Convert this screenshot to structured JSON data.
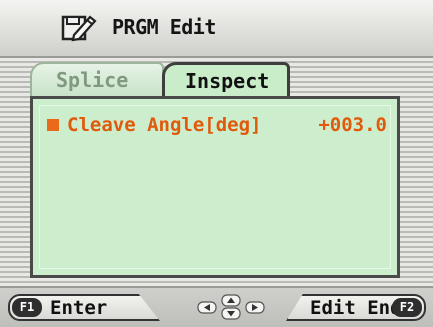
{
  "title": {
    "text": "PRGM Edit",
    "icon": "program-edit-icon"
  },
  "tabs": [
    {
      "label": "Splice",
      "active": false
    },
    {
      "label": "Inspect",
      "active": true
    }
  ],
  "panel": {
    "rows": [
      {
        "label": "Cleave Angle[deg]",
        "value": "+003.0",
        "selected": true
      }
    ]
  },
  "footer": {
    "f1_key": "F1",
    "f1_label": "Enter",
    "nav_icon": "arrow-keys-icon",
    "f2_key": "F2",
    "f2_label": "Edit End"
  },
  "colors": {
    "panel_bg": "#cdeecd",
    "highlight": "#e05a0c",
    "active_tab": "#c9edc9"
  }
}
